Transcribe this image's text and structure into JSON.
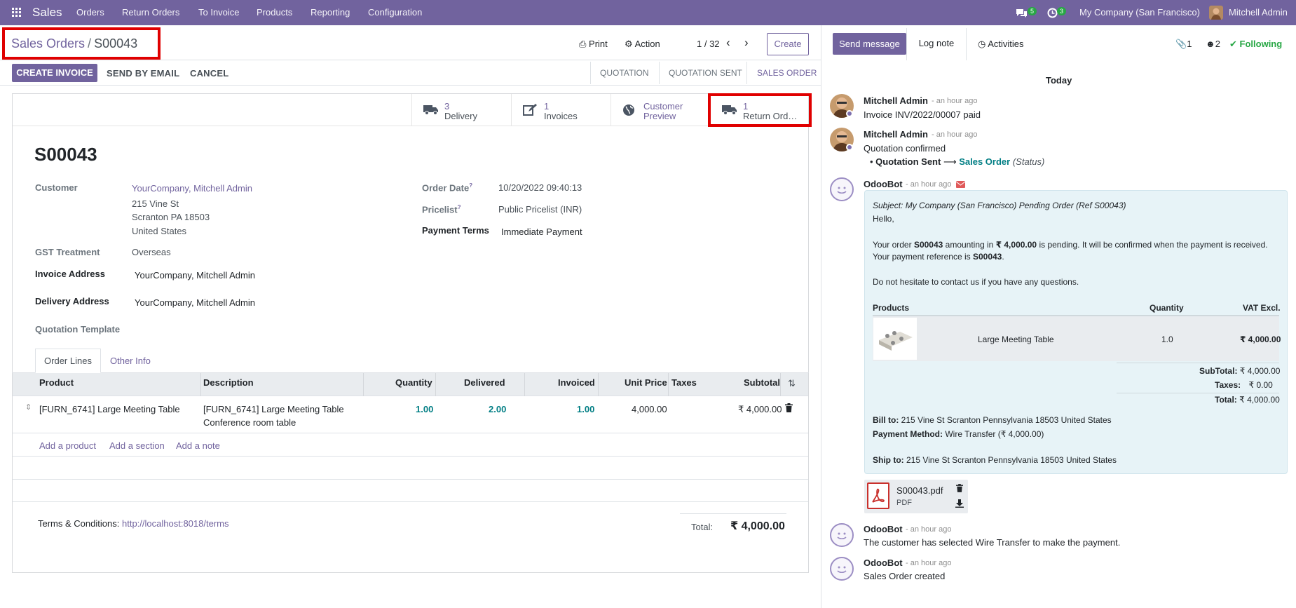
{
  "navbar": {
    "app_name": "Sales",
    "menu": [
      "Orders",
      "Return Orders",
      "To Invoice",
      "Products",
      "Reporting",
      "Configuration"
    ],
    "messages_count": "5",
    "activities_count": "3",
    "company": "My Company (San Francisco)",
    "user": "Mitchell Admin"
  },
  "breadcrumb": {
    "parent": "Sales Orders",
    "current": "S00043"
  },
  "control": {
    "print": "Print",
    "action": "Action",
    "pager": "1 / 32",
    "create": "Create"
  },
  "actions": {
    "create_invoice": "CREATE INVOICE",
    "send_by_email": "SEND BY EMAIL",
    "cancel": "CANCEL"
  },
  "stages": [
    "QUOTATION",
    "QUOTATION SENT",
    "SALES ORDER"
  ],
  "smart_buttons": [
    {
      "value": "3",
      "label": "Delivery",
      "icon": "truck-icon"
    },
    {
      "value": "1",
      "label": "Invoices",
      "icon": "edit-icon"
    },
    {
      "value": "Customer",
      "label": "Preview",
      "icon": "globe-icon"
    },
    {
      "value": "1",
      "label": "Return Ord…",
      "icon": "truck-icon"
    }
  ],
  "record": {
    "name": "S00043",
    "customer_label": "Customer",
    "customer": "YourCompany, Mitchell Admin",
    "address": [
      "215 Vine St",
      "Scranton PA 18503",
      "United States"
    ],
    "gst_label": "GST Treatment",
    "gst": "Overseas",
    "invoice_address_label": "Invoice Address",
    "invoice_address": "YourCompany, Mitchell Admin",
    "delivery_address_label": "Delivery Address",
    "delivery_address": "YourCompany, Mitchell Admin",
    "quotation_template_label": "Quotation Template",
    "order_date_label": "Order Date",
    "order_date": "10/20/2022 09:40:13",
    "pricelist_label": "Pricelist",
    "pricelist": "Public Pricelist (INR)",
    "payment_terms_label": "Payment Terms",
    "payment_terms": "Immediate Payment",
    "help_mark": "?"
  },
  "tabs": [
    "Order Lines",
    "Other Info"
  ],
  "table": {
    "headers": [
      "Product",
      "Description",
      "Quantity",
      "Delivered",
      "Invoiced",
      "Unit Price",
      "Taxes",
      "Subtotal"
    ],
    "rows": [
      {
        "product": "[FURN_6741] Large Meeting Table",
        "description": [
          "[FURN_6741] Large Meeting Table",
          "Conference room table"
        ],
        "quantity": "1.00",
        "delivered": "2.00",
        "invoiced": "1.00",
        "unit_price": "4,000.00",
        "taxes": "",
        "subtotal": "₹ 4,000.00"
      }
    ],
    "add_product": "Add a product",
    "add_section": "Add a section",
    "add_note": "Add a note"
  },
  "footer": {
    "terms_label": "Terms & Conditions:",
    "terms_link": "http://localhost:8018/terms",
    "total_label": "Total:",
    "total": "₹ 4,000.00"
  },
  "chatter": {
    "send_message": "Send message",
    "log_note": "Log note",
    "activities": "Activities",
    "attachments_count": "1",
    "followers_count": "2",
    "following": "Following",
    "today": "Today",
    "messages": [
      {
        "author": "Mitchell Admin",
        "time": "- an hour ago",
        "body": "Invoice INV/2022/00007 paid"
      },
      {
        "author": "Mitchell Admin",
        "time": "- an hour ago",
        "body": "Quotation confirmed",
        "tracking_old": "Quotation Sent",
        "tracking_new": "Sales Order",
        "tracking_field": "(Status)"
      },
      {
        "author": "OdooBot",
        "time": "- an hour ago"
      },
      {
        "author": "OdooBot",
        "time": "- an hour ago",
        "body": "The customer has selected Wire Transfer to make the payment."
      },
      {
        "author": "OdooBot",
        "time": "- an hour ago",
        "body": "Sales Order created"
      }
    ],
    "email": {
      "subject": "Subject: My Company (San Francisco) Pending Order (Ref S00043)",
      "hello": "Hello,",
      "line1_a": "Your order ",
      "line1_b": "S00043",
      "line1_c": " amounting in ",
      "line1_d": "₹ 4,000.00",
      "line1_e": " is pending. It will be confirmed when the payment is received.",
      "line2_a": "Your payment reference is ",
      "line2_b": "S00043",
      "line2_c": ".",
      "line3": "Do not hesitate to contact us if you have any questions.",
      "col_products": "Products",
      "col_quantity": "Quantity",
      "col_vat": "VAT Excl.",
      "product_name": "Large Meeting Table",
      "product_qty": "1.0",
      "product_price": "₹ 4,000.00",
      "subtotal_label": "SubTotal:",
      "subtotal": "₹ 4,000.00",
      "taxes_label": "Taxes:",
      "taxes": "₹ 0.00",
      "total_label": "Total:",
      "total": "₹ 4,000.00",
      "bill_to_label": "Bill to:",
      "bill_to": "215 Vine St Scranton Pennsylvania 18503 United States",
      "payment_label": "Payment Method:",
      "payment": "Wire Transfer (₹ 4,000.00)",
      "ship_to_label": "Ship to:",
      "ship_to": "215 Vine St Scranton Pennsylvania 18503 United States"
    },
    "attachment": {
      "name": "S00043.pdf",
      "type": "PDF"
    }
  }
}
